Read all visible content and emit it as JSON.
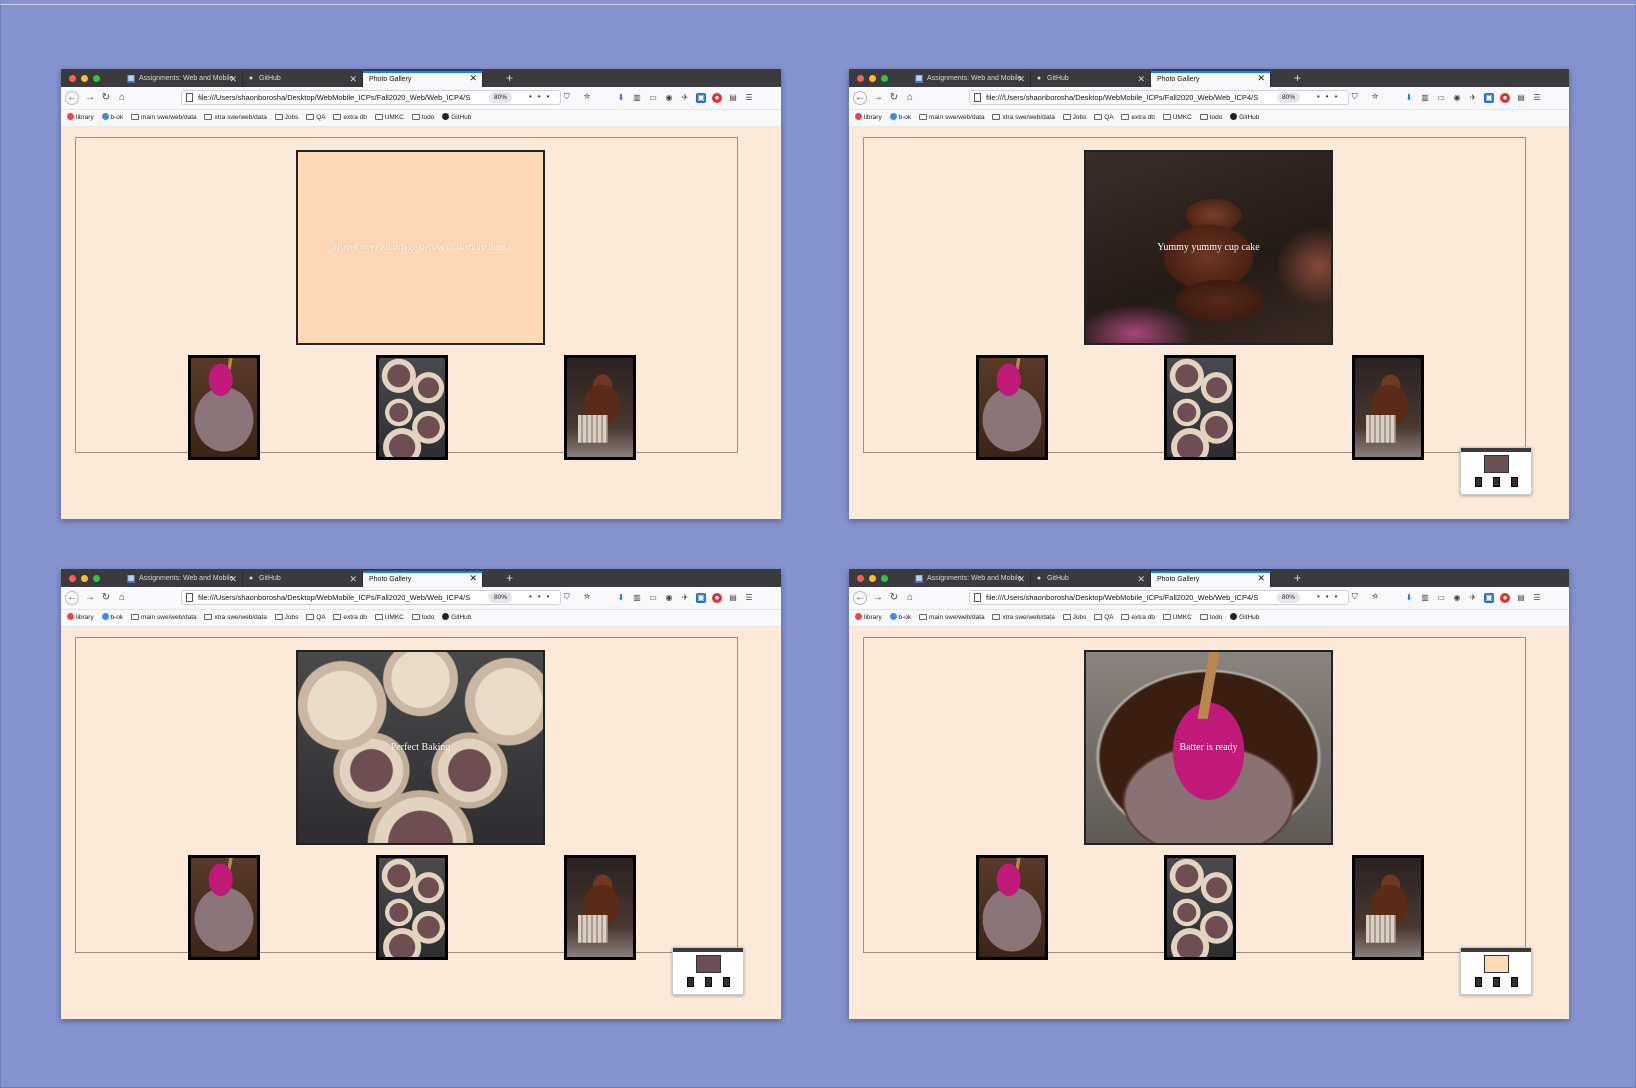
{
  "browser": {
    "tabs": [
      {
        "label": "Assignments: Web and Mobile",
        "icon": "canvas-icon"
      },
      {
        "label": "GitHub",
        "icon": "github-icon"
      },
      {
        "label": "Photo Gallery",
        "icon": "",
        "active": true
      }
    ],
    "url": "file:///Users/shaonborosha/Desktop/WebMobile_ICPs/Fall2020_Web/Web_ICP4/S",
    "zoom": "80%",
    "bookmarks": [
      "library",
      "b-ok",
      "main swe/web/data",
      "xtra swe/web/data",
      "Jobs",
      "QA",
      "extra db",
      "UMKC",
      "todo",
      "GitHub"
    ]
  },
  "panels": [
    {
      "display_text": "Hover over an image below to display here.",
      "display_image": "none",
      "mini_preview": false
    },
    {
      "display_text": "Yummy yummy cup cake",
      "display_image": "cupcake",
      "mini_preview": true,
      "mini_preview_image": "batter"
    },
    {
      "display_text": "Perfect Baking",
      "display_image": "tin",
      "mini_preview": true,
      "mini_preview_image": "batter"
    },
    {
      "display_text": "Batter is ready",
      "display_image": "batter",
      "mini_preview": true,
      "mini_preview_image": "none"
    }
  ],
  "thumbnails": [
    {
      "alt": "Batter is ready",
      "image": "batter"
    },
    {
      "alt": "Perfect Baking",
      "image": "tin"
    },
    {
      "alt": "Yummy yummy cup cake",
      "image": "cupcake"
    }
  ],
  "colors": {
    "desktop": "#8592ce",
    "page_background": "#fbeada",
    "display_empty": "#ffd9b6"
  }
}
